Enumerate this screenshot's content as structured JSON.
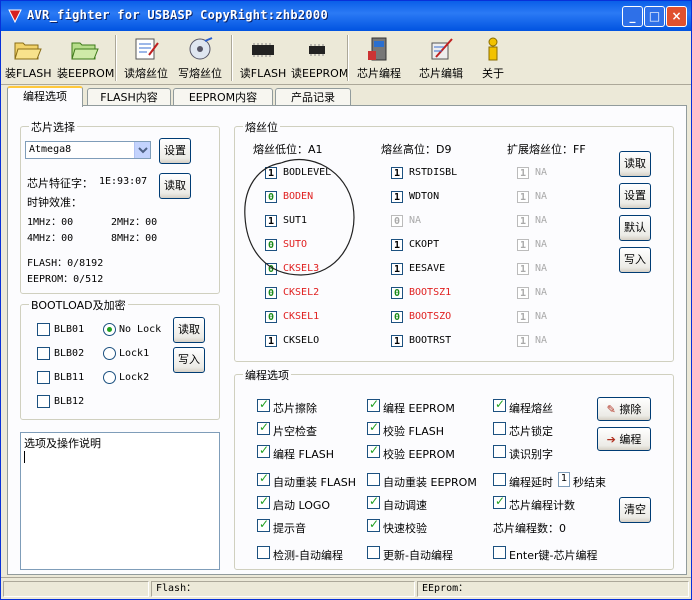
{
  "window": {
    "title": "AVR_fighter for USBASP CopyRight:zhb2000",
    "min": "_",
    "max": "□",
    "close": "×"
  },
  "toolbar": [
    {
      "label": "装FLASH",
      "icon": "folder-open-icon"
    },
    {
      "label": "装EEPROM",
      "icon": "folder-open-icon"
    },
    {
      "label": "读熔丝位",
      "icon": "read-fuse-icon"
    },
    {
      "label": "写熔丝位",
      "icon": "write-fuse-icon"
    },
    {
      "label": "读FLASH",
      "icon": "chip-read-icon"
    },
    {
      "label": "读EEPROM",
      "icon": "chip-read-icon"
    },
    {
      "label": "芯片编程",
      "icon": "program-chip-icon"
    },
    {
      "label": "芯片编辑",
      "icon": "edit-chip-icon"
    },
    {
      "label": "关于",
      "icon": "about-icon"
    }
  ],
  "tabs": [
    "编程选项",
    "FLASH内容",
    "EEPROM内容",
    "产品记录"
  ],
  "chip": {
    "group": "芯片选择",
    "selected": "Atmega8",
    "sig_label": "芯片特征字：",
    "sig_value": "1E:93:07",
    "btn_set": "设置",
    "btn_read": "读取",
    "osc_label": "时钟效准：",
    "osc": [
      "1MHz：00",
      "2MHz：00",
      "4MHz：00",
      "8MHz：00"
    ],
    "flash": "FLASH：0/8192",
    "eeprom": "EEPROM：0/512"
  },
  "boot": {
    "group": "BOOTLOAD及加密",
    "items": [
      {
        "label": "BLB01",
        "on": false
      },
      {
        "label": "BLB02",
        "on": false
      },
      {
        "label": "BLB11",
        "on": false
      },
      {
        "label": "BLB12",
        "on": false
      }
    ],
    "radios": [
      {
        "label": "No Lock",
        "on": true
      },
      {
        "label": "Lock1",
        "on": false
      },
      {
        "label": "Lock2",
        "on": false
      }
    ],
    "btn_read": "读取",
    "btn_write": "写入"
  },
  "notes": {
    "label": "选项及操作说明"
  },
  "fuse": {
    "group": "熔丝位",
    "low_label": "熔丝低位：A1",
    "high_label": "熔丝高位：D9",
    "ext_label": "扩展熔丝位：FF",
    "low": [
      {
        "v": "1",
        "n": "BODLEVEL",
        "s": ""
      },
      {
        "v": "0",
        "n": "BODEN",
        "s": "red"
      },
      {
        "v": "1",
        "n": "SUT1",
        "s": ""
      },
      {
        "v": "0",
        "n": "SUTO",
        "s": "red"
      },
      {
        "v": "0",
        "n": "CKSEL3",
        "s": "red"
      },
      {
        "v": "0",
        "n": "CKSEL2",
        "s": "red"
      },
      {
        "v": "0",
        "n": "CKSEL1",
        "s": "red"
      },
      {
        "v": "1",
        "n": "CKSELO",
        "s": ""
      }
    ],
    "high": [
      {
        "v": "1",
        "n": "RSTDISBL",
        "s": ""
      },
      {
        "v": "1",
        "n": "WDTON",
        "s": ""
      },
      {
        "v": "0",
        "n": "NA",
        "s": "gray"
      },
      {
        "v": "1",
        "n": "CKOPT",
        "s": ""
      },
      {
        "v": "1",
        "n": "EESAVE",
        "s": ""
      },
      {
        "v": "0",
        "n": "BOOTSZ1",
        "s": "red"
      },
      {
        "v": "0",
        "n": "BOOTSZO",
        "s": "red"
      },
      {
        "v": "1",
        "n": "BOOTRST",
        "s": ""
      }
    ],
    "ext": [
      {
        "v": "1",
        "n": "NA"
      },
      {
        "v": "1",
        "n": "NA"
      },
      {
        "v": "1",
        "n": "NA"
      },
      {
        "v": "1",
        "n": "NA"
      },
      {
        "v": "1",
        "n": "NA"
      },
      {
        "v": "1",
        "n": "NA"
      },
      {
        "v": "1",
        "n": "NA"
      },
      {
        "v": "1",
        "n": "NA"
      }
    ],
    "buttons": [
      "读取",
      "设置",
      "默认",
      "写入"
    ]
  },
  "prog": {
    "group": "编程选项",
    "col1": [
      {
        "label": "芯片擦除",
        "on": true
      },
      {
        "label": "片空检查",
        "on": true
      },
      {
        "label": "编程 FLASH",
        "on": true
      }
    ],
    "col2": [
      {
        "label": "编程 EEPROM",
        "on": true
      },
      {
        "label": "校验 FLASH",
        "on": true
      },
      {
        "label": "校验 EEPROM",
        "on": true
      }
    ],
    "col3": [
      {
        "label": "编程熔丝",
        "on": true
      },
      {
        "label": "芯片锁定",
        "on": false
      },
      {
        "label": "读识别字",
        "on": false
      }
    ],
    "row4": [
      {
        "label": "自动重装 FLASH",
        "on": true
      },
      {
        "label": "自动重装 EEPROM",
        "on": false
      },
      {
        "label": "编程延时",
        "on": false
      }
    ],
    "delay_value": "1",
    "delay_suffix": "秒结束",
    "row5": [
      {
        "label": "启动 LOGO",
        "on": true
      },
      {
        "label": "自动调速",
        "on": true
      },
      {
        "label": "芯片编程计数",
        "on": true
      }
    ],
    "row6": [
      {
        "label": "提示音",
        "on": true
      },
      {
        "label": "快速校验",
        "on": true
      }
    ],
    "count_label": "芯片编程数：0",
    "row7": [
      {
        "label": "检测-自动编程",
        "on": false
      },
      {
        "label": "更新-自动编程",
        "on": false
      },
      {
        "label": "Enter键-芯片编程",
        "on": false
      }
    ],
    "btn_erase": "擦除",
    "btn_program": "编程",
    "btn_clear": "清空"
  },
  "status": {
    "flash": "Flash：",
    "eeprom": "EEprom："
  }
}
